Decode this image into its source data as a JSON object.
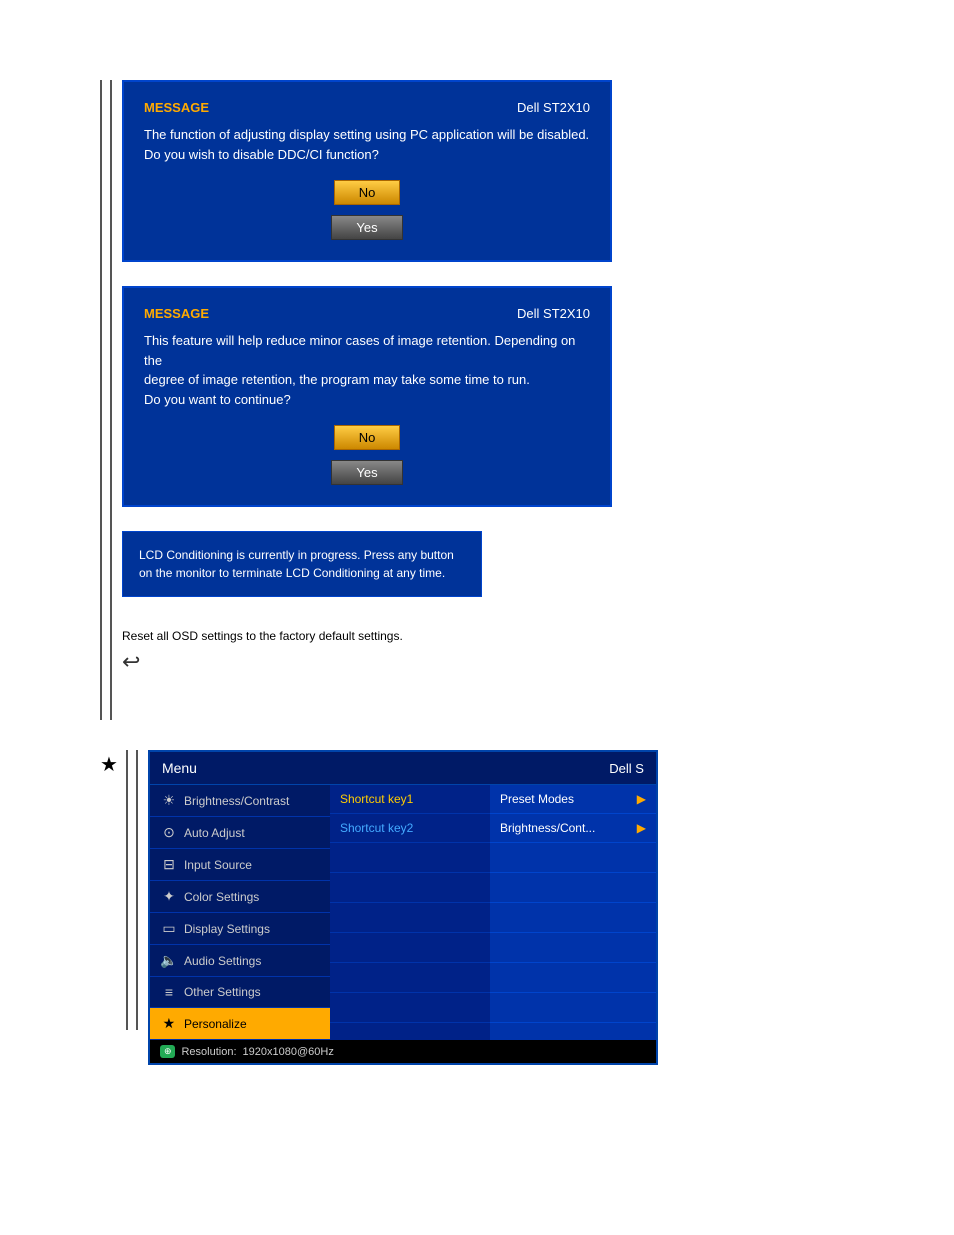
{
  "page": {
    "background": "#ffffff"
  },
  "dialog1": {
    "title": "MESSAGE",
    "brand": "Dell ST2X10",
    "body_line1": "The function of adjusting display setting using PC application will be disabled.",
    "body_line2": "Do you wish to disable DDC/CI function?",
    "btn_no": "No",
    "btn_yes": "Yes"
  },
  "dialog2": {
    "title": "MESSAGE",
    "brand": "Dell ST2X10",
    "body_line1": "This feature will help reduce minor cases of image retention. Depending on the",
    "body_line2": "degree of image retention, the program may take some time to run.",
    "body_line3": "Do you want to continue?",
    "btn_no": "No",
    "btn_yes": "Yes"
  },
  "lcd_box": {
    "line1": "LCD Conditioning is currently in progress. Press any button",
    "line2": "on the monitor to terminate LCD Conditioning at any time."
  },
  "reset_section": {
    "text": "Reset all OSD settings to the factory default settings."
  },
  "menu": {
    "title": "Menu",
    "brand": "Dell S",
    "items": [
      {
        "icon": "☀",
        "label": "Brightness/Contrast"
      },
      {
        "icon": "⊙",
        "label": "Auto Adjust"
      },
      {
        "icon": "⊟",
        "label": "Input Source"
      },
      {
        "icon": "✦",
        "label": "Color Settings"
      },
      {
        "icon": "▭",
        "label": "Display Settings"
      },
      {
        "icon": "🔈",
        "label": "Audio Settings"
      },
      {
        "icon": "≡",
        "label": "Other Settings"
      },
      {
        "icon": "★",
        "label": "Personalize",
        "active": true
      }
    ],
    "shortcuts": [
      {
        "label": "Shortcut key1"
      },
      {
        "label": "Shortcut key2"
      }
    ],
    "shortcut_values": [
      {
        "value": "Preset Modes"
      },
      {
        "value": "Brightness/Cont..."
      }
    ],
    "footer": {
      "resolution_label": "Resolution:",
      "resolution_value": "1920x1080@60Hz"
    }
  }
}
